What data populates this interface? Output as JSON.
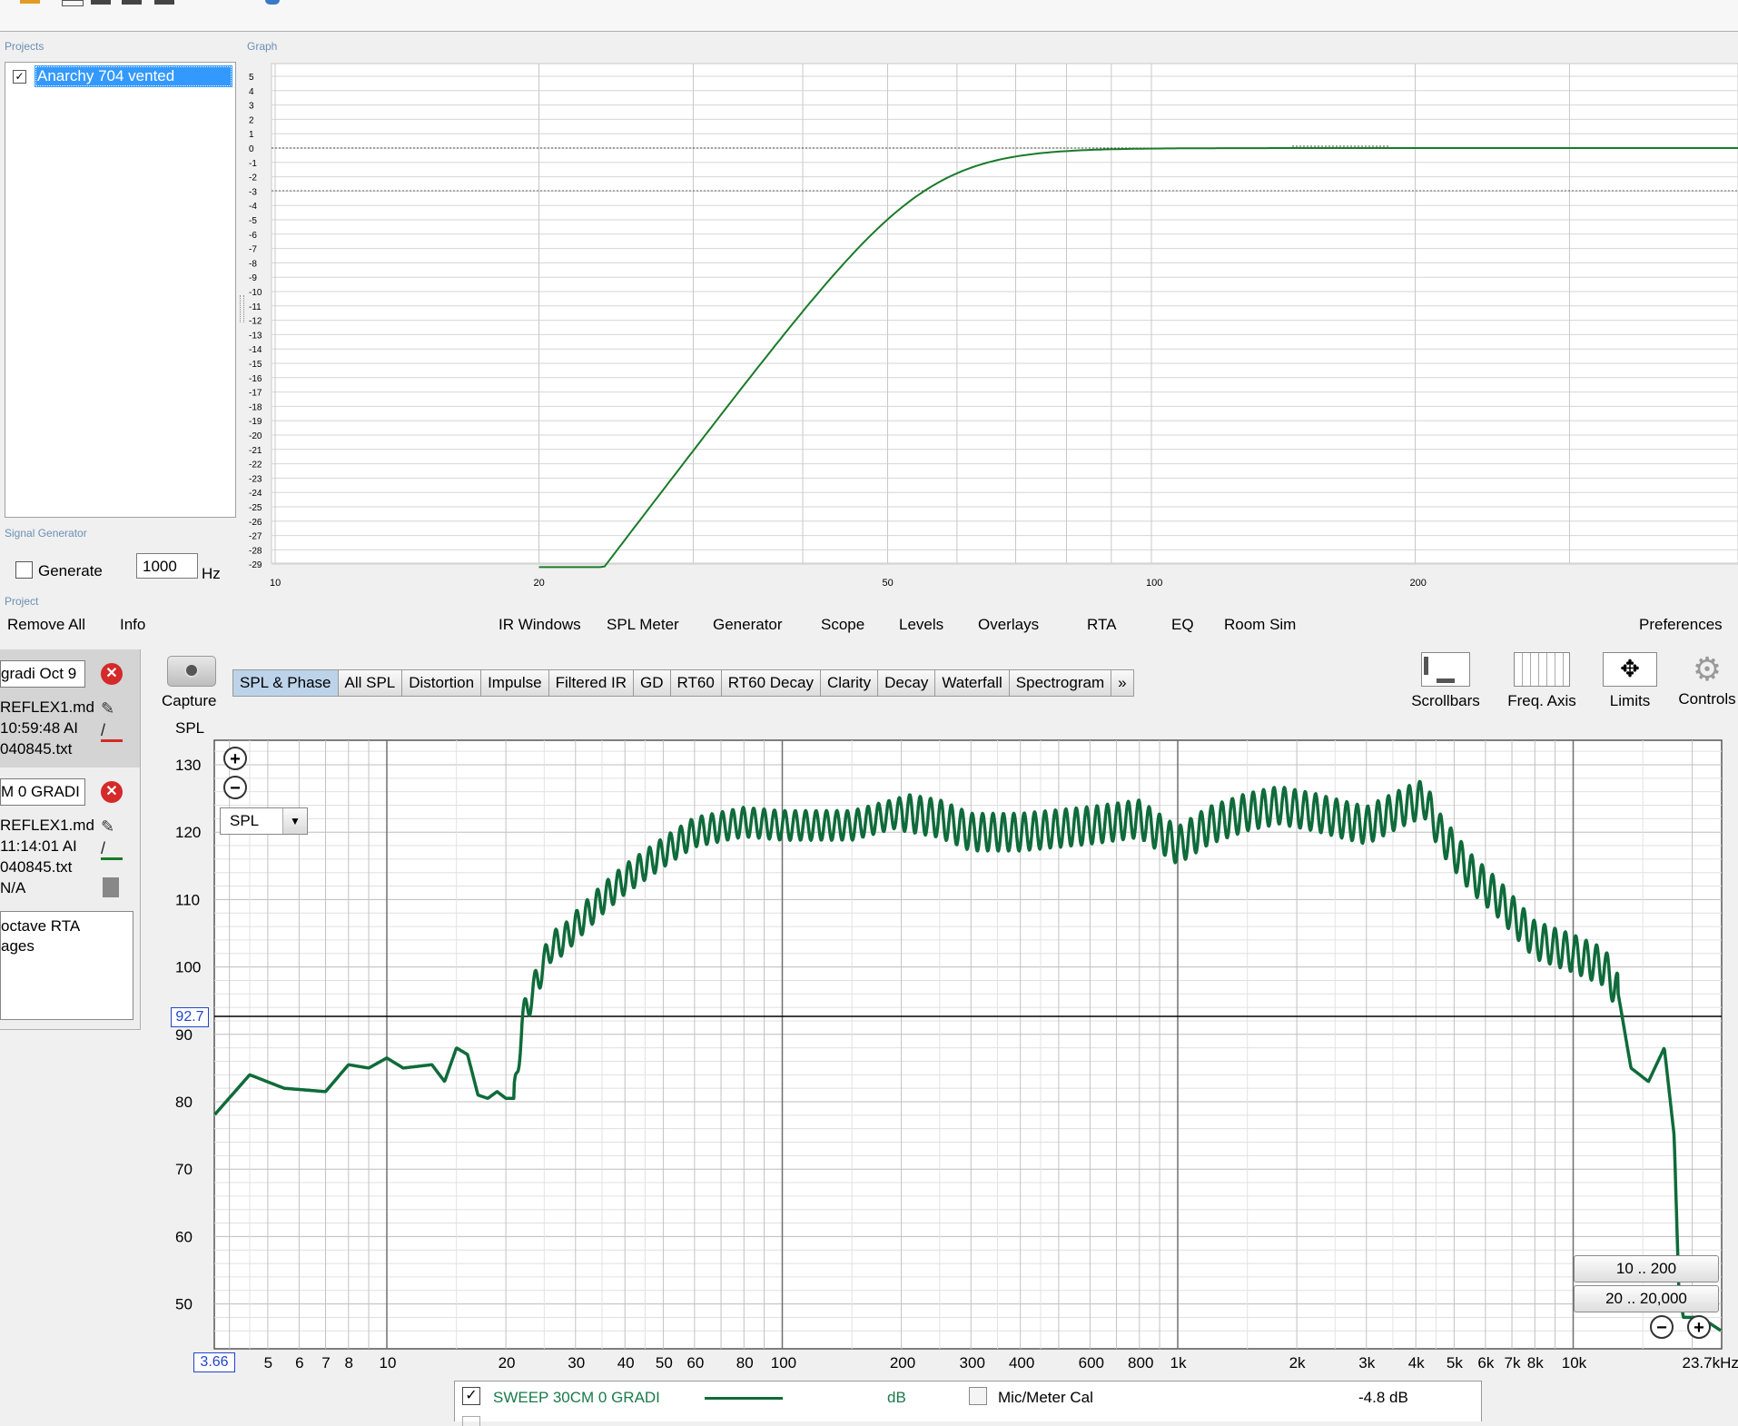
{
  "projects_panel": {
    "label": "Projects",
    "project_name": "Anarchy 704 vented",
    "checked": true
  },
  "graph_panel": {
    "label": "Graph",
    "y_ticks": [
      "5",
      "4",
      "3",
      "2",
      "1",
      "0",
      "-1",
      "-2",
      "-3",
      "-4",
      "-5",
      "-6",
      "-7",
      "-8",
      "-9",
      "-10",
      "-11",
      "-12",
      "-13",
      "-14",
      "-15",
      "-16",
      "-17",
      "-18",
      "-19",
      "-20",
      "-21",
      "-22",
      "-23",
      "-24",
      "-25",
      "-26",
      "-27",
      "-28",
      "-29"
    ],
    "x_ticks": [
      "10",
      "20",
      "50",
      "100",
      "200"
    ]
  },
  "signal_generator": {
    "label": "Signal Generator",
    "generate_label": "Generate",
    "frequency_value": "1000",
    "unit": "Hz"
  },
  "project_label": "Project",
  "menubar": {
    "left": [
      "Remove All",
      "Info"
    ],
    "center": [
      "IR Windows",
      "SPL Meter",
      "Generator",
      "Scope",
      "Levels",
      "Overlays",
      "RTA",
      "EQ",
      "Room Sim"
    ],
    "right": "Preferences"
  },
  "measurements": [
    {
      "name": "gradi Oct 9",
      "file": "REFLEX1.md",
      "time": "10:59:48 AI",
      "id": "040845.txt"
    },
    {
      "name": "M 0 GRADI",
      "file": "REFLEX1.md",
      "time": "11:14:01 AI",
      "id": "040845.txt",
      "extra": "N/A"
    }
  ],
  "notes_box": [
    "octave RTA",
    "ages"
  ],
  "capture_label": "Capture",
  "tabs": [
    "SPL & Phase",
    "All SPL",
    "Distortion",
    "Impulse",
    "Filtered IR",
    "GD",
    "RT60",
    "RT60 Decay",
    "Clarity",
    "Decay",
    "Waterfall",
    "Spectrogram",
    "»"
  ],
  "active_tab": "SPL & Phase",
  "toolbar_right": [
    "Scrollbars",
    "Freq. Axis",
    "Limits",
    "Controls"
  ],
  "spl_axis_label": "SPL",
  "spl_dropdown": "SPL",
  "cursor_readout_y": "92.7",
  "cursor_readout_x": "3.66",
  "range_buttons": [
    "10 .. 200",
    "20 .. 20,000"
  ],
  "spl_y_ticks": [
    "130",
    "120",
    "110",
    "100",
    "90",
    "80",
    "70",
    "60",
    "50"
  ],
  "spl_x_ticks": [
    "5",
    "6",
    "7",
    "8",
    "10",
    "20",
    "30",
    "40",
    "50",
    "60",
    "80",
    "100",
    "200",
    "300",
    "400",
    "600",
    "800",
    "1k",
    "2k",
    "3k",
    "4k",
    "5k",
    "6k",
    "7k",
    "8k",
    "10k",
    "23.7kHz"
  ],
  "legend": {
    "trace_name": "SWEEP 30CM 0 GRADI",
    "unit": "dB",
    "mic_cal_label": "Mic/Meter Cal",
    "offset": "-4.8 dB"
  },
  "colors": {
    "trace_green": "#1a7a2a",
    "spl_trace": "#0f6b3a",
    "selection_blue": "#3399ff"
  }
}
